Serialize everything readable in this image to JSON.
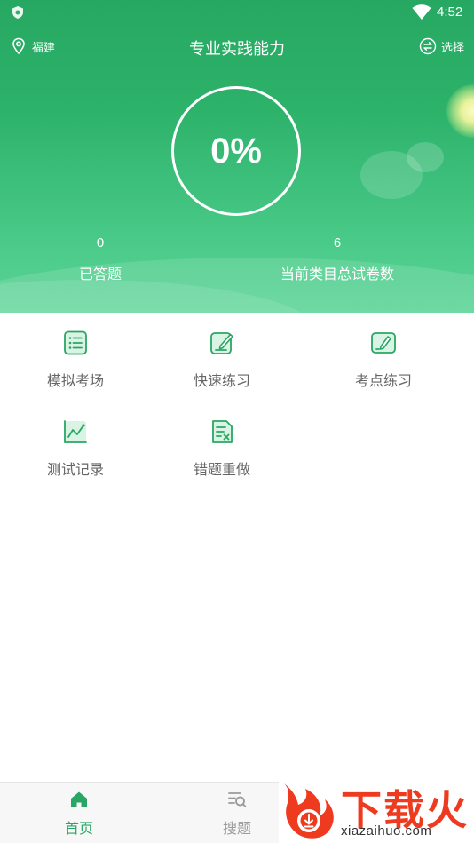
{
  "status_bar": {
    "time": "4:52"
  },
  "nav": {
    "location": "福建",
    "title": "专业实践能力",
    "select_label": "选择"
  },
  "progress": {
    "value_text": "0%",
    "fraction": 0.0
  },
  "stats": {
    "answered": {
      "value": "0",
      "label": "已答题"
    },
    "total_papers": {
      "value": "6",
      "label": "当前类目总试卷数"
    }
  },
  "menu": [
    {
      "label": "模拟考场",
      "icon": "exam-list-icon"
    },
    {
      "label": "快速练习",
      "icon": "edit-note-icon"
    },
    {
      "label": "考点练习",
      "icon": "pen-board-icon"
    },
    {
      "label": "测试记录",
      "icon": "chart-record-icon"
    },
    {
      "label": "错题重做",
      "icon": "wrong-answer-icon"
    }
  ],
  "tabs": [
    {
      "label": "首页",
      "icon": "home-icon",
      "active": true
    },
    {
      "label": "搜题",
      "icon": "search-list-icon",
      "active": false
    }
  ],
  "watermark": {
    "title": "下载火",
    "url": "xiazaihuo.com"
  },
  "colors": {
    "brand_green": "#2aa664",
    "header_top": "#27a862",
    "header_bottom": "#5bd497",
    "label_gray": "#666666",
    "watermark_red": "#ee3b1f"
  }
}
